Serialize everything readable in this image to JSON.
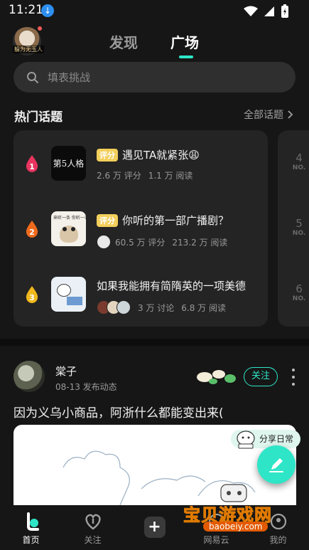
{
  "status_bar": {
    "time": "11:21"
  },
  "top_nav": {
    "avatar_caption": "躲为无玉人",
    "tabs": [
      "发现",
      "广场"
    ],
    "active_tab": "广场"
  },
  "search": {
    "placeholder": "填表挑战"
  },
  "hot_topics": {
    "title": "热门话题",
    "more_label": "全部话题",
    "items": [
      {
        "rank": "1",
        "tag": "评分",
        "title": "遇见TA就紧张😩",
        "stat1": "2.6 万 评分",
        "stat2": "1.1 万 阅读",
        "thumb_text": "第5人格"
      },
      {
        "rank": "2",
        "tag": "评分",
        "title": "你听的第一部广播剧？",
        "stat1": "60.5 万 评分",
        "stat2": "213.2 万 阅读",
        "thumb_text": "来听一条 你听一条"
      },
      {
        "rank": "3",
        "tag": "",
        "title": "如果我能拥有简隋英的一项美德",
        "stat1": "3 万 讨论",
        "stat2": "6.8 万 阅读",
        "thumb_text": ""
      }
    ],
    "side_ranks": [
      {
        "num": "4",
        "label": "NO."
      },
      {
        "num": "5",
        "label": "NO."
      },
      {
        "num": "6",
        "label": "NO."
      }
    ]
  },
  "post": {
    "author": "棠子",
    "subtitle": "08-13 发布动态",
    "follow_label": "关注",
    "text": "因为义乌小商品，阿浙什么都能变出来("
  },
  "share": {
    "label": "分享日常"
  },
  "bottom_nav": {
    "items": [
      {
        "label": "首页",
        "active": true
      },
      {
        "label": "关注",
        "active": false
      },
      {
        "label": "+",
        "active": false
      },
      {
        "label": "网易云",
        "active": false
      },
      {
        "label": "我的",
        "active": false
      }
    ]
  },
  "watermark": {
    "text": "宝贝游戏网",
    "url": "baobeiy.com"
  },
  "colors": {
    "accent": "#2ee6c7",
    "tag_yellow": "#f2cf5b",
    "background": "#161616",
    "card": "#242424"
  }
}
